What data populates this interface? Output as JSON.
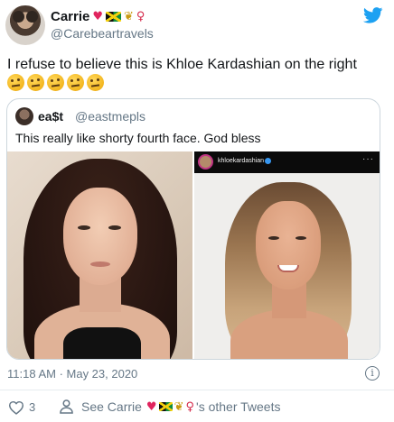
{
  "tweet": {
    "author": {
      "display_name": "Carrie",
      "name_emoji": [
        "red-heart",
        "jamaica-flag",
        "pineapple",
        "dancer"
      ],
      "handle": "@Carebeartravels"
    },
    "text": "I refuse to believe this is Khloe Kardashian on the right",
    "reaction_emoji": [
      "face-with-raised-eyebrow",
      "face-with-raised-eyebrow",
      "face-with-raised-eyebrow",
      "face-with-raised-eyebrow",
      "face-with-raised-eyebrow"
    ],
    "timestamp": "11:18 AM · May 23, 2020"
  },
  "quote": {
    "display_name": "ea$t",
    "handle": "@eastmepls",
    "text": "This really like shorty fourth face. God bless",
    "instagram_overlay": {
      "username": "khloekardashian",
      "more": "···"
    }
  },
  "footer": {
    "like_count": "3",
    "see_prefix": "See Carrie",
    "see_suffix": "'s other Tweets"
  },
  "colors": {
    "twitter_blue": "#1da1f2",
    "heart_red": "#e0245e",
    "secondary_text": "#657786",
    "border": "#ccd6dd"
  }
}
